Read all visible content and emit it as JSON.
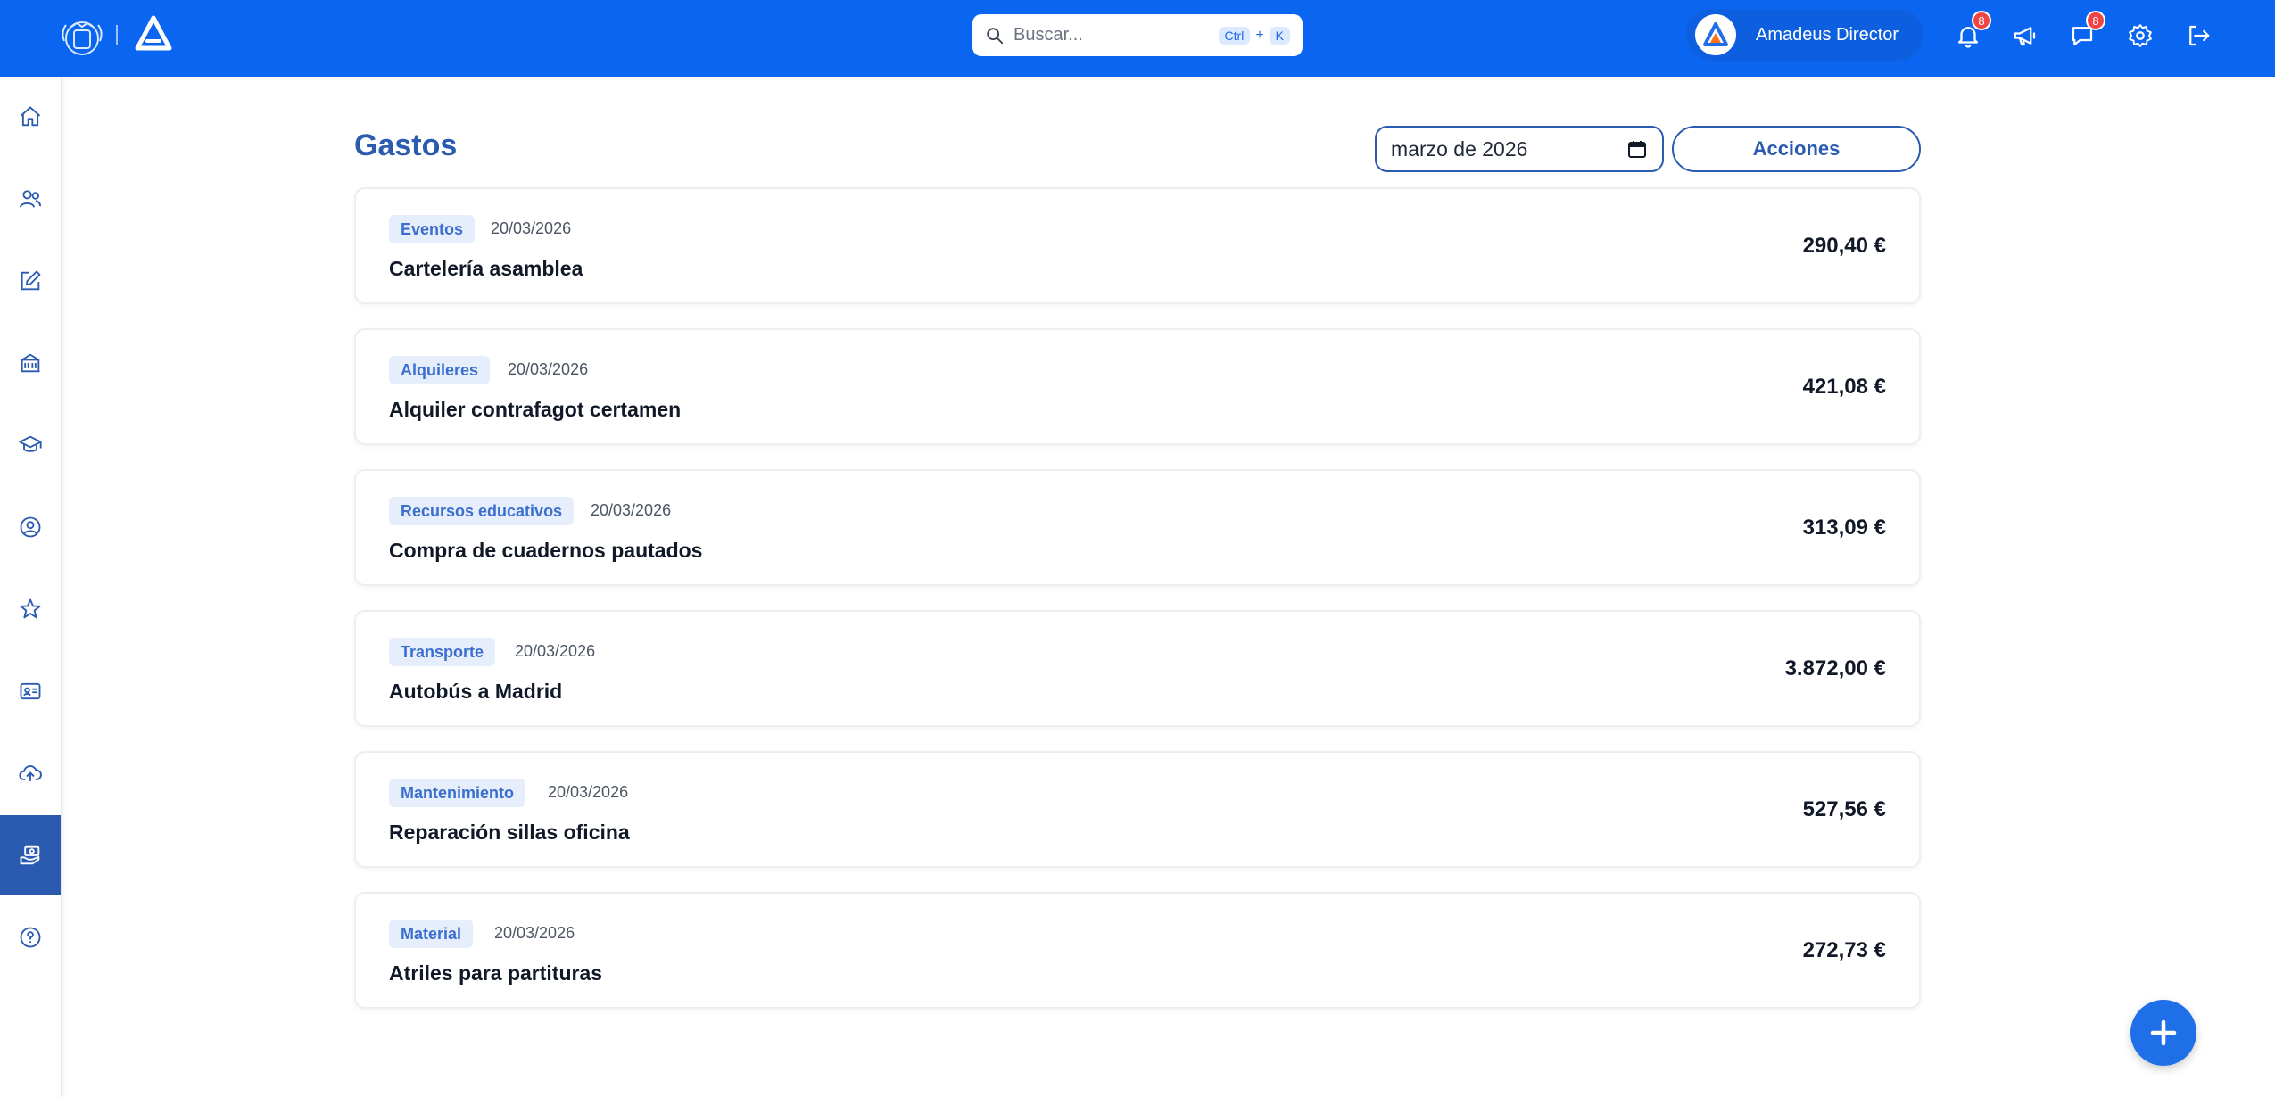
{
  "header": {
    "search_placeholder": "Buscar...",
    "shortcut_ctrl": "Ctrl",
    "shortcut_plus": "+",
    "shortcut_key": "K",
    "user_name": "Amadeus Director",
    "notifications_count": "8",
    "messages_count": "8",
    "icons": [
      "bell-icon",
      "megaphone-icon",
      "chat-icon",
      "gear-icon",
      "logout-icon"
    ]
  },
  "sidebar": {
    "items": [
      "home-icon",
      "users-icon",
      "edit-icon",
      "building-icon",
      "graduation-cap-icon",
      "user-circle-icon",
      "star-icon",
      "id-card-icon",
      "cloud-upload-icon",
      "money-hand-icon",
      "help-icon"
    ],
    "active": "money-hand-icon"
  },
  "main": {
    "title": "Gastos",
    "month_value": "marzo de 2026",
    "actions_label": "Acciones",
    "expenses": [
      {
        "category": "Eventos",
        "date": "20/03/2026",
        "title": "Cartelería asamblea",
        "amount": "290,40 €"
      },
      {
        "category": "Alquileres",
        "date": "20/03/2026",
        "title": "Alquiler contrafagot certamen",
        "amount": "421,08 €"
      },
      {
        "category": "Recursos educativos",
        "date": "20/03/2026",
        "title": "Compra de cuadernos pautados",
        "amount": "313,09 €"
      },
      {
        "category": "Transporte",
        "date": "20/03/2026",
        "title": "Autobús a Madrid",
        "amount": "3.872,00 €"
      },
      {
        "category": "Mantenimiento",
        "date": "20/03/2026",
        "title": "Reparación sillas oficina",
        "amount": "527,56 €"
      },
      {
        "category": "Material",
        "date": "20/03/2026",
        "title": "Atriles para partituras",
        "amount": "272,73 €"
      }
    ]
  },
  "colors": {
    "topbar": "#0a66f0",
    "accent": "#2b5bb0",
    "tag_bg": "#e6eefb",
    "badge": "#ef4444"
  }
}
